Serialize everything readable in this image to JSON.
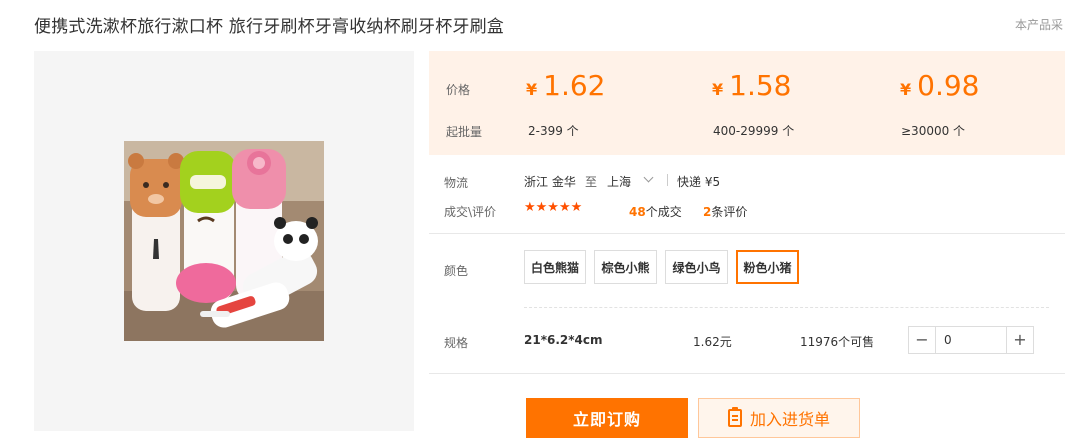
{
  "product": {
    "title": "便携式洗漱杯旅行漱口杯 旅行牙刷杯牙膏收纳杯刷牙杯牙刷盒",
    "corner_text": "本产品采"
  },
  "price_section": {
    "price_label": "价格",
    "batch_label": "起批量",
    "currency": "¥",
    "tiers": [
      {
        "price": "1.62",
        "range": "2-399 个"
      },
      {
        "price": "1.58",
        "range": "400-29999 个"
      },
      {
        "price": "0.98",
        "range": "≥30000 个"
      }
    ]
  },
  "logistics": {
    "label": "物流",
    "from": "浙江 金华",
    "to_word": "至",
    "to": "上海",
    "shipping": "快递 ¥5"
  },
  "deals": {
    "label": "成交\\评价",
    "stars": "★★★★★",
    "deals_count": "48",
    "deals_suffix": "个成交",
    "review_count": "2",
    "review_suffix": "条评价"
  },
  "color": {
    "label": "颜色",
    "options": [
      "白色熊猫",
      "棕色小熊",
      "绿色小鸟",
      "粉色小猪"
    ],
    "selected_index": 3
  },
  "spec": {
    "label": "规格",
    "size": "21*6.2*4cm",
    "price": "1.62元",
    "stock": "11976个可售",
    "quantity": "0"
  },
  "actions": {
    "buy_label": "立即订购",
    "cart_label": "加入进货单"
  },
  "colors": {
    "accent": "#ff7300",
    "price_bg": "#fff2e8",
    "stars": "#ff5000"
  }
}
